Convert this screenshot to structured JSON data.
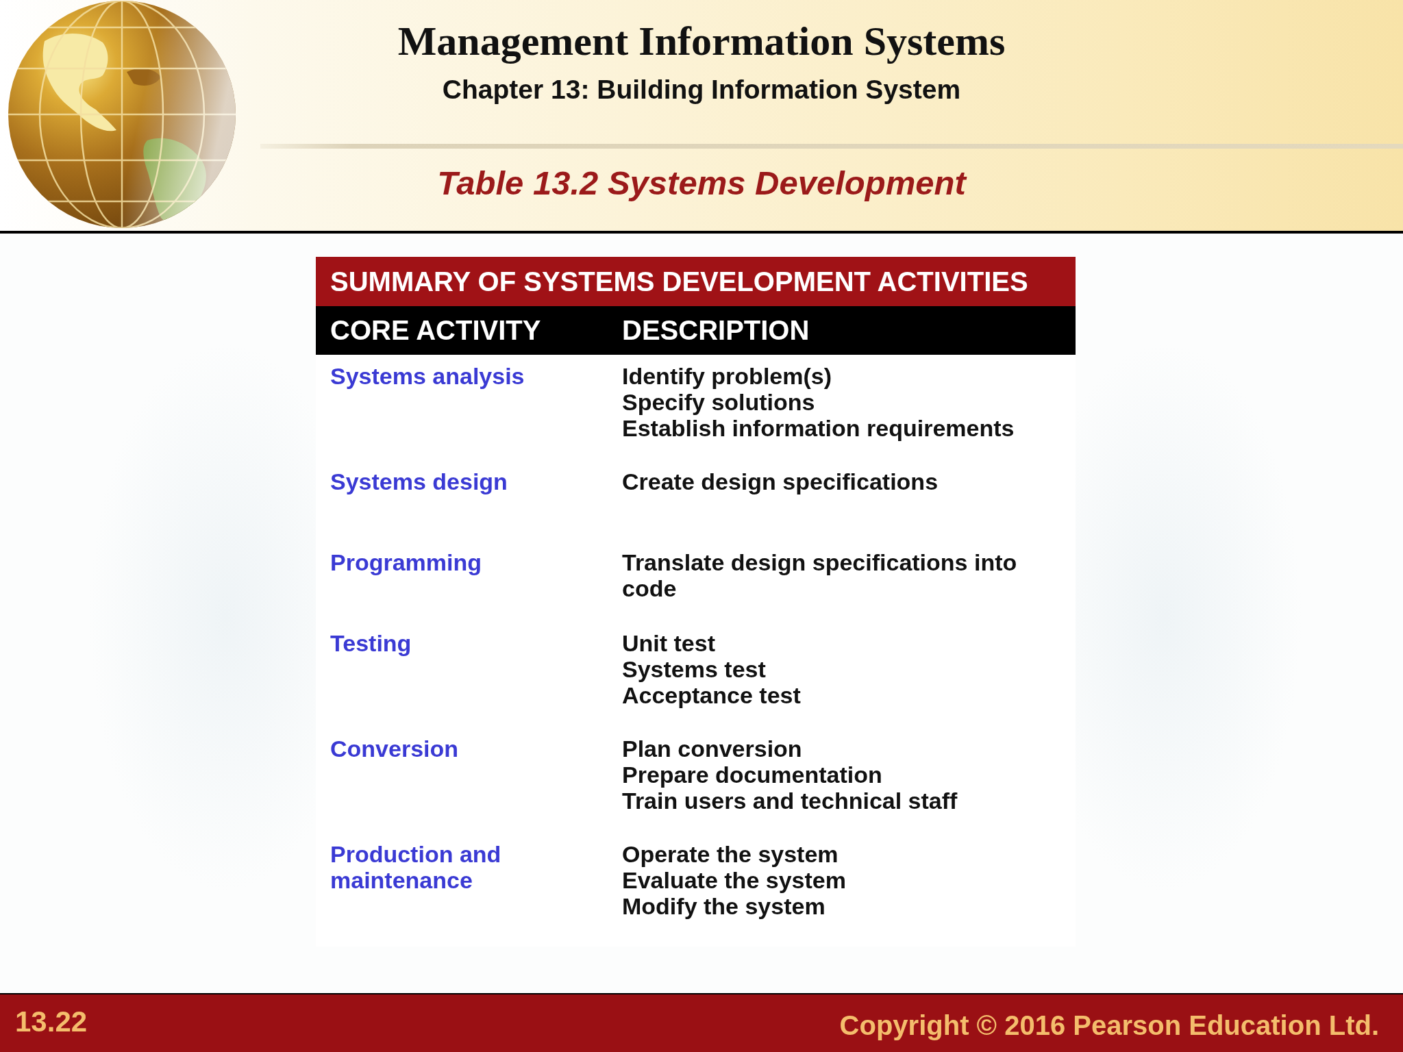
{
  "header": {
    "title": "Management Information Systems",
    "subtitle": "Chapter 13: Building Information System",
    "slide_heading": "Table 13.2 Systems Development"
  },
  "table": {
    "caption": "SUMMARY OF SYSTEMS DEVELOPMENT ACTIVITIES",
    "columns": [
      "CORE ACTIVITY",
      "DESCRIPTION"
    ],
    "rows": [
      {
        "activity": "Systems analysis",
        "description": [
          "Identify problem(s)",
          "Specify solutions",
          "Establish information requirements"
        ]
      },
      {
        "activity": "Systems design",
        "description": [
          "Create design specifications"
        ]
      },
      {
        "activity": "Programming",
        "description": [
          "Translate design specifications into code"
        ]
      },
      {
        "activity": "Testing",
        "description": [
          "Unit test",
          "Systems test",
          "Acceptance test"
        ]
      },
      {
        "activity": "Conversion",
        "description": [
          "Plan conversion",
          "Prepare documentation",
          "Train users and technical staff"
        ]
      },
      {
        "activity": "Production and maintenance",
        "description": [
          "Operate the system",
          "Evaluate the system",
          "Modify the system"
        ]
      }
    ]
  },
  "footer": {
    "slide_number": "13.22",
    "copyright": "Copyright © 2016 Pearson Education Ltd."
  }
}
